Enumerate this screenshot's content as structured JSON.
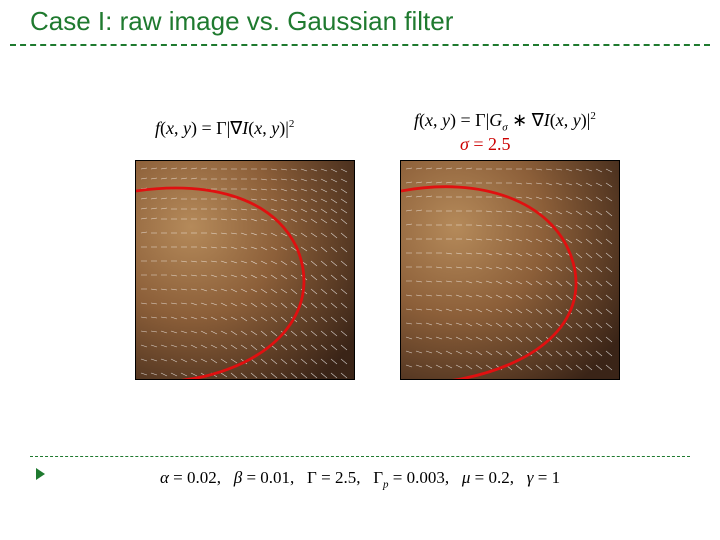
{
  "title": "Case I: raw image vs. Gaussian filter",
  "left": {
    "func": "f",
    "paren_open": "(",
    "x": "x",
    "comma1": ", ",
    "y": "y",
    "paren_close": ")",
    "eq": " = ",
    "Gamma": "Γ",
    "pipe1": "|",
    "nabla": "∇",
    "I": "I",
    "pipe2": "|",
    "sq": "2"
  },
  "right": {
    "func": "f",
    "paren_open": "(",
    "x": "x",
    "comma1": ", ",
    "y": "y",
    "paren_close": ")",
    "eq": " = ",
    "Gamma": "Γ",
    "pipe1": "|",
    "G": "G",
    "sigma_sub": "σ",
    "ast": " ∗ ",
    "nabla": "∇",
    "I": "I",
    "pipe2": "|",
    "sq": "2"
  },
  "sigma": {
    "sym": "σ",
    "eq": " = ",
    "val": "2.5"
  },
  "params": {
    "alpha_sym": "α",
    "alpha_val": "0.02",
    "beta_sym": "β",
    "beta_val": "0.01",
    "Gamma_sym": "Γ",
    "Gamma_val": "2.5",
    "Gammap_sym": "Γ",
    "Gammap_sub": "p",
    "Gammap_val": "0.003",
    "mu_sym": "μ",
    "mu_val": "0.2",
    "gamma_sym": "γ",
    "gamma_val": "1",
    "eq": " = ",
    "sep": ",   "
  }
}
